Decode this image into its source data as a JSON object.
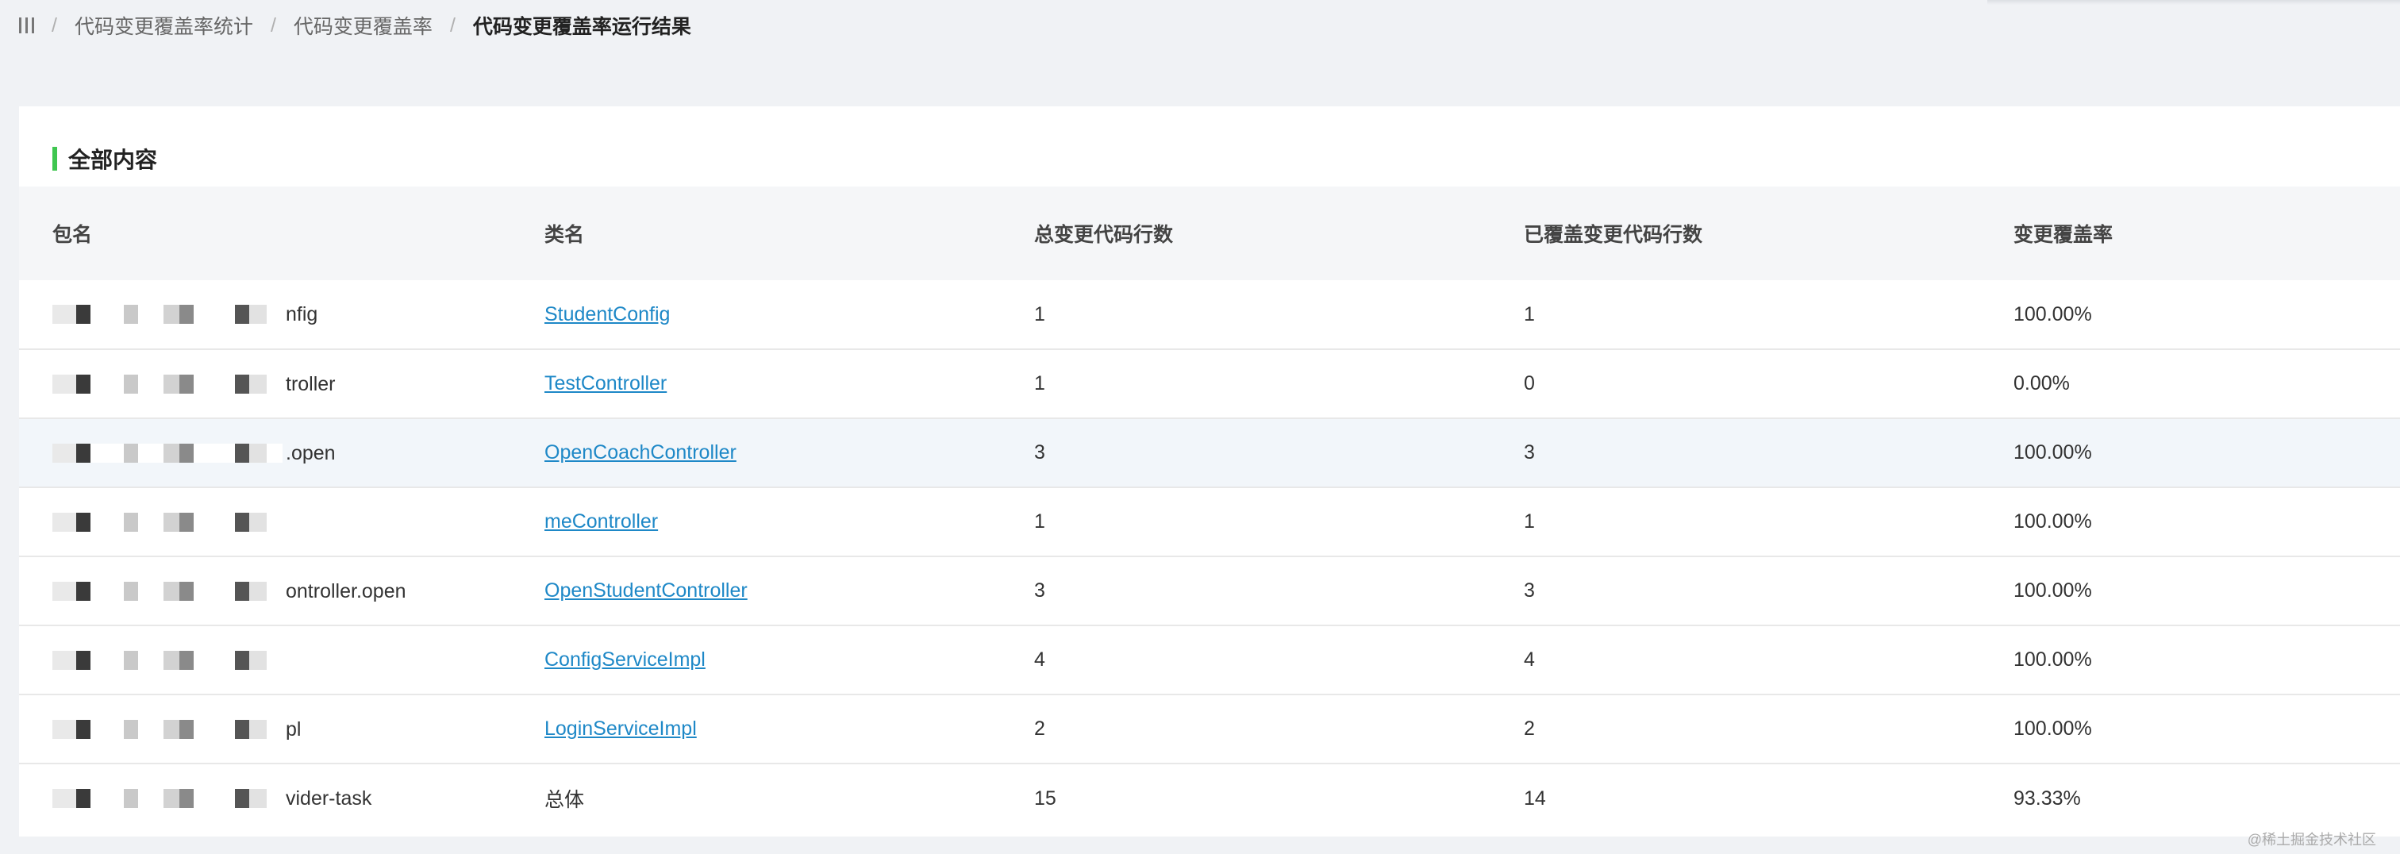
{
  "breadcrumb": {
    "menu_icon": "menu-icon",
    "items": [
      "代码变更覆盖率统计",
      "代码变更覆盖率",
      "代码变更覆盖率运行结果"
    ],
    "separator": "/"
  },
  "section": {
    "title": "全部内容",
    "accent_color": "#3fc650"
  },
  "table": {
    "columns": [
      "包名",
      "类名",
      "总变更代码行数",
      "已覆盖变更代码行数",
      "变更覆盖率"
    ],
    "rows": [
      {
        "package_visible": "nfig",
        "class_name": "StudentConfig",
        "total": "1",
        "covered": "1",
        "rate": "100.00%",
        "link": true
      },
      {
        "package_visible": "troller",
        "class_name": "TestController",
        "total": "1",
        "covered": "0",
        "rate": "0.00%",
        "link": true
      },
      {
        "package_visible": ".open",
        "class_name": "OpenCoachController",
        "total": "3",
        "covered": "3",
        "rate": "100.00%",
        "link": true
      },
      {
        "package_visible": "",
        "class_name": "meController",
        "total": "1",
        "covered": "1",
        "rate": "100.00%",
        "link": true
      },
      {
        "package_visible": "ontroller.open",
        "class_name": "OpenStudentController",
        "total": "3",
        "covered": "3",
        "rate": "100.00%",
        "link": true
      },
      {
        "package_visible": "",
        "class_name": "ConfigServiceImpl",
        "total": "4",
        "covered": "4",
        "rate": "100.00%",
        "link": true
      },
      {
        "package_visible": "pl",
        "class_name": "LoginServiceImpl",
        "total": "2",
        "covered": "2",
        "rate": "100.00%",
        "link": true
      },
      {
        "package_visible": "vider-task",
        "class_name": "总体",
        "total": "15",
        "covered": "14",
        "rate": "93.33%",
        "link": false
      }
    ],
    "highlighted_row": 3
  },
  "watermark": "@稀土掘金技术社区",
  "colors": {
    "link": "#1e88c7",
    "header_bg": "#f5f6f8",
    "page_bg": "#f0f2f5"
  }
}
